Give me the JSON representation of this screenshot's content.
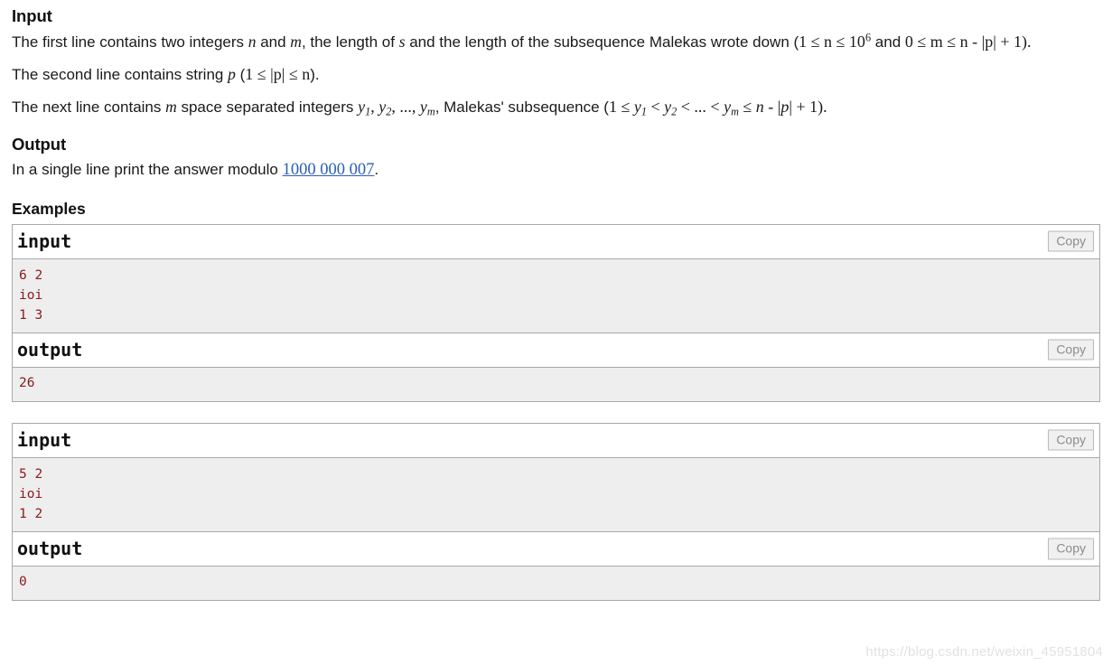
{
  "sections": {
    "input": {
      "heading": "Input",
      "p1_a": "The first line contains two integers ",
      "p1_n": "n",
      "p1_b": " and ",
      "p1_m": "m",
      "p1_c": ", the length of ",
      "p1_s": "s",
      "p1_d": " and the length of the subsequence Malekas wrote down (",
      "p1_math1": "1 ≤ n ≤ 10",
      "p1_exp": "6",
      "p1_e": " and",
      "p1_math2": "0 ≤ m ≤ n - |p| + 1).",
      "p2_a": "The second line contains string ",
      "p2_p": "p",
      "p2_b": " (",
      "p2_math": "1 ≤ |p| ≤ n",
      "p2_c": ").",
      "p3_a": "The next line contains ",
      "p3_m": "m",
      "p3_b": " space separated integers ",
      "p3_y1": "y",
      "p3_y1sub": "1",
      "p3_sep1": ", ",
      "p3_y2": "y",
      "p3_y2sub": "2",
      "p3_sep2": ", ..., ",
      "p3_ym": "y",
      "p3_ymsub": "m",
      "p3_c": ", Malekas' subsequence (",
      "p3_math": "1 ≤ y₁ < y₂ < ... < y_m ≤ n - |p| + 1).",
      "p3_m1": "1 ≤ ",
      "p3_m2": " < ",
      "p3_m3": " < ... < ",
      "p3_m4": " ≤ ",
      "p3_m5": "n",
      "p3_m6": " - |",
      "p3_m7": "p",
      "p3_m8": "| + 1)."
    },
    "output": {
      "heading": "Output",
      "text_before": "In a single line print the answer modulo ",
      "link_text": "1000 000 007",
      "text_after": "."
    },
    "examples": {
      "heading": "Examples",
      "copy_label": "Copy",
      "groups": [
        {
          "input_label": "input",
          "input_content": "6 2\nioi\n1 3",
          "output_label": "output",
          "output_content": "26"
        },
        {
          "input_label": "input",
          "input_content": "5 2\nioi\n1 2",
          "output_label": "output",
          "output_content": "0"
        }
      ]
    }
  },
  "watermark": "https://blog.csdn.net/weixin_45951804",
  "colors": {
    "code_text": "#8b1a1a",
    "code_bg": "#eeeeee",
    "link": "#2b5fb3",
    "border": "#a8a8a8"
  }
}
